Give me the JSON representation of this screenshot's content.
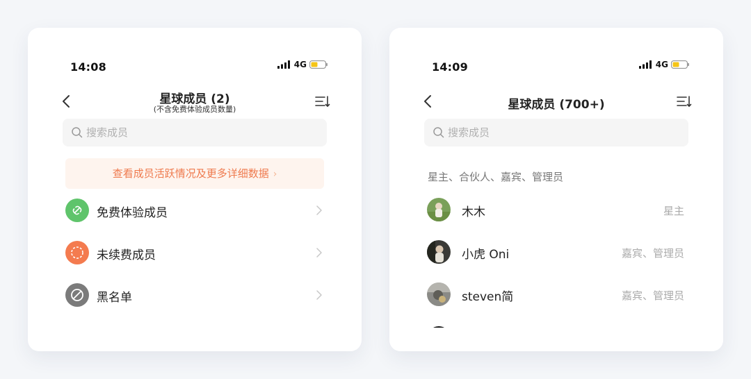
{
  "left_screen": {
    "status": {
      "time": "14:08",
      "network": "4G"
    },
    "title": "星球成员 (2)",
    "subtitle": "(不含免费体验成员数量)",
    "search": {
      "placeholder": "搜索成员"
    },
    "banner": {
      "label": "查看成员活跃情况及更多详细数据"
    },
    "menu": [
      {
        "label": "免费体验成员",
        "icon": "link-icon",
        "color": "#5fc46b"
      },
      {
        "label": "未续费成员",
        "icon": "renew-icon",
        "color": "#f47b4f"
      },
      {
        "label": "黑名单",
        "icon": "block-icon",
        "color": "#7b7b7b"
      }
    ]
  },
  "right_screen": {
    "status": {
      "time": "14:09",
      "network": "4G"
    },
    "title": "星球成员 (700+)",
    "search": {
      "placeholder": "搜索成员"
    },
    "section_header": "星主、合伙人、嘉宾、管理员",
    "members": [
      {
        "name": "木木",
        "role": "星主"
      },
      {
        "name": "小虎 Oni",
        "role": "嘉宾、管理员"
      },
      {
        "name": "steven简",
        "role": "嘉宾、管理员"
      }
    ]
  },
  "colors": {
    "accent_orange": "#ef7a4e",
    "banner_bg": "#fef4ee",
    "battery_fill": "#f5c518",
    "page_bg": "#f4f6f9"
  }
}
